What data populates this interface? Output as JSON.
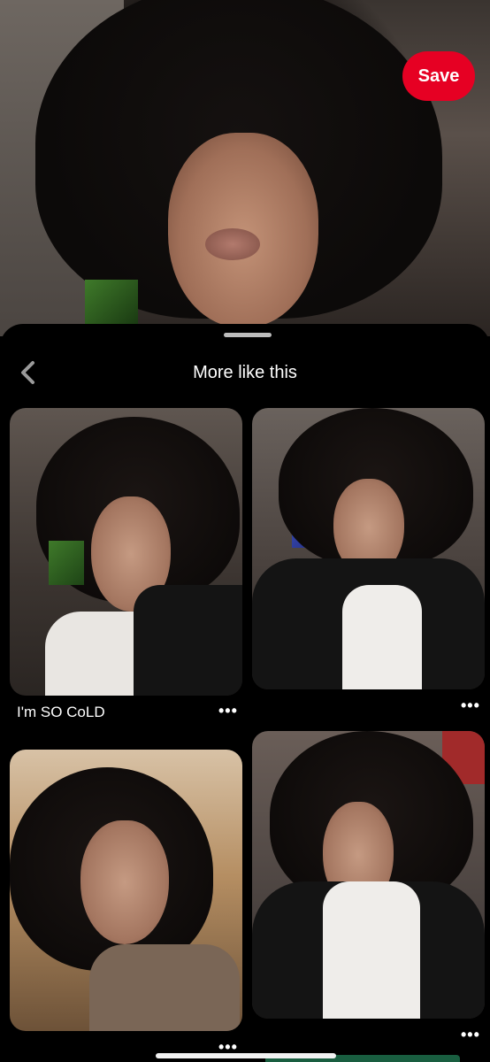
{
  "hero": {
    "save_label": "Save"
  },
  "sheet": {
    "title": "More like this"
  },
  "pins": [
    {
      "caption": "I'm SO CoLD",
      "more": "•••"
    },
    {
      "caption": "",
      "more": "•••"
    },
    {
      "caption": "",
      "more": "•••"
    },
    {
      "caption": "",
      "more": "•••"
    }
  ],
  "colors": {
    "brand_red": "#e60023",
    "background": "#000000",
    "text": "#ffffff"
  },
  "icons": {
    "back": "chevron-left-icon",
    "more": "ellipsis-icon"
  }
}
